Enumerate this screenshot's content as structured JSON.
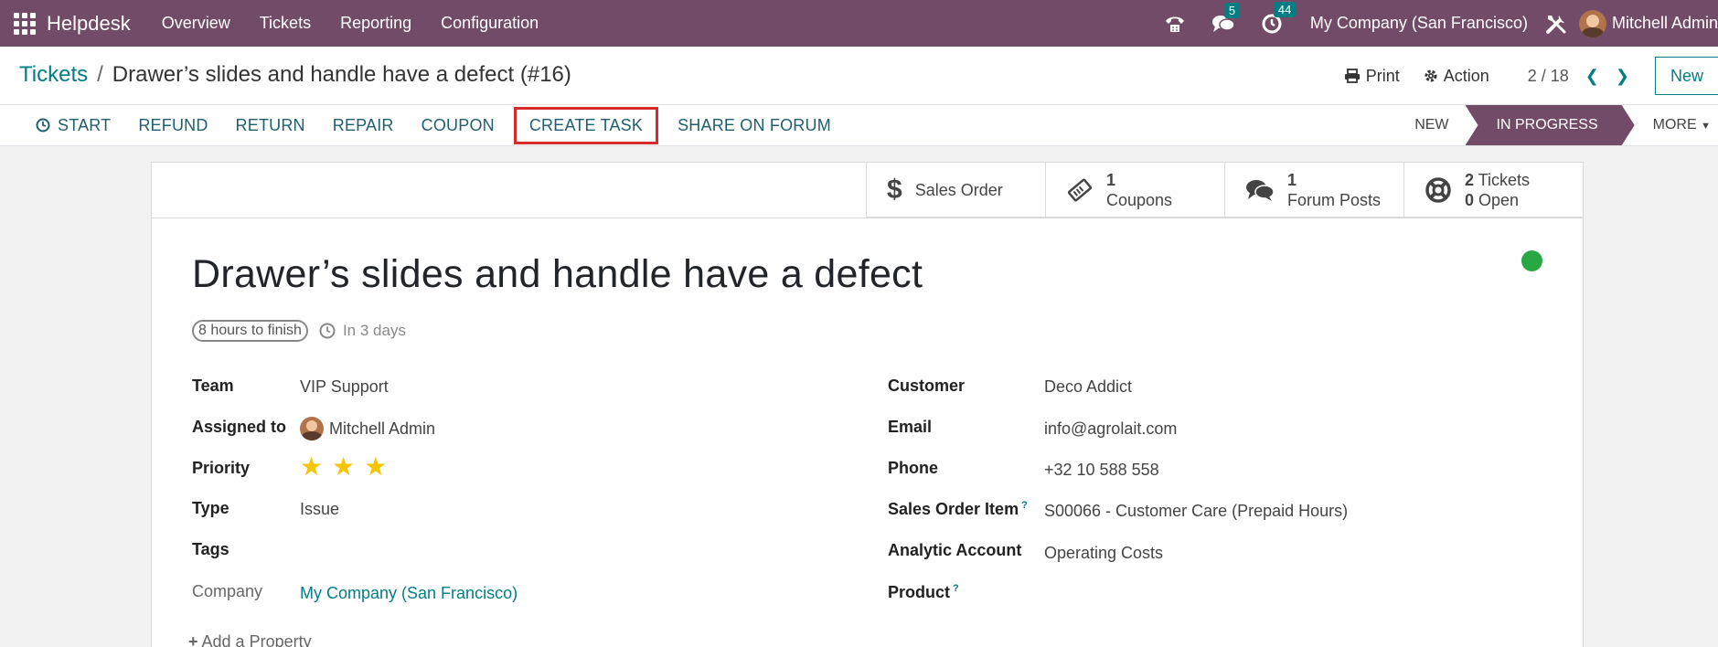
{
  "navbar": {
    "brand": "Helpdesk",
    "menu": [
      "Overview",
      "Tickets",
      "Reporting",
      "Configuration"
    ],
    "messages_count": "5",
    "activities_count": "44",
    "company": "My Company (San Francisco)",
    "user": "Mitchell Admin"
  },
  "breadcrumb": {
    "parent": "Tickets",
    "separator": "/",
    "current": "Drawer’s slides and handle have a defect (#16)"
  },
  "control": {
    "print_label": "Print",
    "action_label": "Action",
    "pager": "2 / 18",
    "new_label": "New"
  },
  "actions": {
    "start": "START",
    "refund": "REFUND",
    "return": "RETURN",
    "repair": "REPAIR",
    "coupon": "COUPON",
    "create_task": "CREATE TASK",
    "share_forum": "SHARE ON FORUM"
  },
  "stages": {
    "new": "NEW",
    "in_progress": "IN PROGRESS",
    "more": "MORE"
  },
  "smart_buttons": {
    "sales_order": "Sales Order",
    "coupons_count": "1",
    "coupons_label": "Coupons",
    "forum_count": "1",
    "forum_label": "Forum Posts",
    "tickets_count": "2",
    "tickets_label": "Tickets",
    "open_count": "0",
    "open_label": "Open"
  },
  "ticket": {
    "title": "Drawer’s slides and handle have a defect",
    "sla": "8 hours to finish",
    "deadline": "In 3 days"
  },
  "fields_left": {
    "team_label": "Team",
    "team": "VIP Support",
    "assigned_label": "Assigned to",
    "assigned": "Mitchell Admin",
    "priority_label": "Priority",
    "priority_stars": 3,
    "type_label": "Type",
    "type": "Issue",
    "tags_label": "Tags",
    "company_label": "Company",
    "company": "My Company (San Francisco)"
  },
  "fields_right": {
    "customer_label": "Customer",
    "customer": "Deco Addict",
    "email_label": "Email",
    "email": "info@agrolait.com",
    "phone_label": "Phone",
    "phone": "+32 10 588 558",
    "so_item_label": "Sales Order Item",
    "so_item": "S00066 - Customer Care (Prepaid Hours)",
    "analytic_label": "Analytic Account",
    "analytic": "Operating Costs",
    "product_label": "Product"
  },
  "add_property": "Add a Property",
  "colors": {
    "brand": "#714b67",
    "accent": "#017e84",
    "highlight": "#d62b2b",
    "status_ok": "#28a745",
    "star": "#f3c600"
  }
}
